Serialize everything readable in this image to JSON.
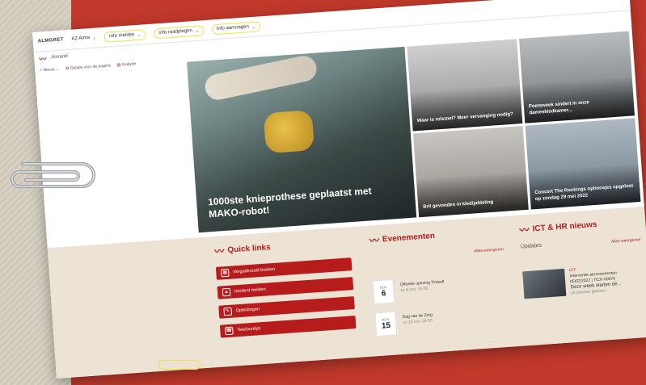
{
  "topbar": {
    "brand": "ALMGRET",
    "items": [
      {
        "label": "AZ Alma",
        "highlight": false
      },
      {
        "label": "Info melden",
        "highlight": true
      },
      {
        "label": "Info raadplegen",
        "highlight": true
      },
      {
        "label": "Info aanvragen",
        "highlight": true
      }
    ]
  },
  "site": {
    "name": "Almaref"
  },
  "commands": {
    "new": "Nieuw",
    "details": "Details voor de pagina",
    "analytics": "Analyse"
  },
  "hero": {
    "main_caption": "1000ste knieprothese geplaatst met MAKO-robot!",
    "tiles": [
      {
        "caption": "Waar is rolstoel? Meer vervanging nodig?"
      },
      {
        "caption": "Poetsweek sindert in onze dameskledkamer..."
      },
      {
        "caption": "Bril gevonden in kledijafdeling"
      },
      {
        "caption": "Concert The Rockings ophoosjes opgelost op zondag 29 mei 2022"
      }
    ]
  },
  "quick_links": {
    "title": "Quick links",
    "items": [
      {
        "label": "Vergaderzaal boeken",
        "icon": "calendar-icon"
      },
      {
        "label": "Incident melden",
        "icon": "warning-icon"
      },
      {
        "label": "Opleidingen",
        "icon": "training-icon"
      },
      {
        "label": "Telefoonlijst",
        "icon": "phone-icon"
      }
    ]
  },
  "events": {
    "title": "Evenementen",
    "see_all": "Alles weergeven",
    "items": [
      {
        "month": "NOV",
        "day": "6",
        "title": "Officiële opening Timeelt",
        "sub": "ze 6 nov, 15:00"
      },
      {
        "month": "NOV",
        "day": "15",
        "title": "Dag van de Zorg",
        "sub": "zo 15 nov, 09:00"
      }
    ]
  },
  "news": {
    "title": "ICT & HR nieuws",
    "see_all": "Alles weergeven",
    "section": "Updates",
    "item": {
      "tag": "ICT",
      "line1": "Interventie abonnementen",
      "line2": "05/02/2022 | TICK-00076",
      "headline": "Deze week starten de...",
      "meta": "nll minuten geleden"
    }
  },
  "colors": {
    "accent": "#b71c1c",
    "background": "#c0392b",
    "highlight": "#f0e04b"
  }
}
